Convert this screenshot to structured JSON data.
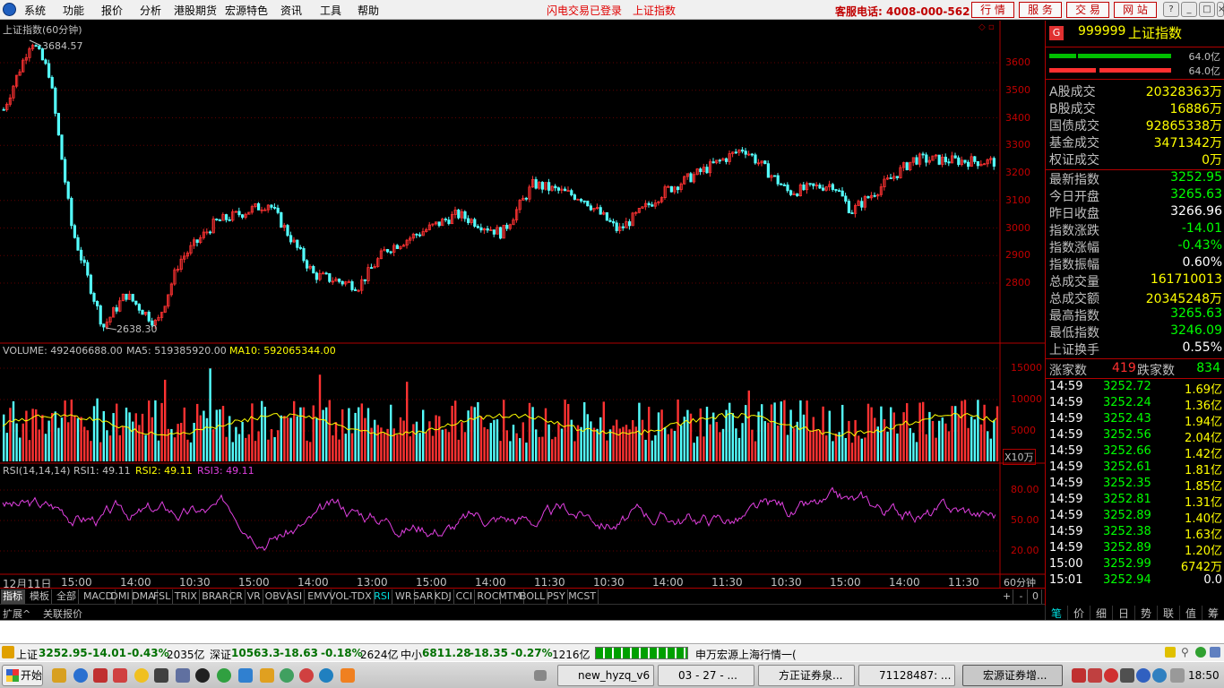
{
  "menu": {
    "items": [
      "系统",
      "功能",
      "报价",
      "分析",
      "港股期货",
      "宏源特色",
      "资讯",
      "工具",
      "帮助"
    ],
    "notice_login": "闪电交易已登录",
    "notice_index": "上证指数",
    "hotline": "客服电话: 4008-000-562",
    "buttons": [
      "行 情",
      "服 务",
      "交 易",
      "网 站"
    ],
    "window_controls": [
      "?",
      "_",
      "□",
      "×"
    ]
  },
  "price_chart": {
    "title": "上证指数(60分钟)",
    "high_label": "3684.57",
    "low_label": "2638.30",
    "y_ticks": [
      "3600",
      "3500",
      "3400",
      "3300",
      "3200",
      "3100",
      "3000",
      "2900",
      "2800"
    ]
  },
  "volume_chart": {
    "label_volume": "VOLUME: 492406688.00",
    "label_ma5": "MA5: 519385920.00",
    "label_ma10": "MA10: 592065344.00",
    "y_ticks": [
      "15000",
      "10000",
      "5000"
    ],
    "unit": "X10万"
  },
  "rsi_chart": {
    "label_params": "RSI(14,14,14)",
    "label_rsi1": "RSI1: 49.11",
    "label_rsi2": "RSI2: 49.11",
    "label_rsi3": "RSI3: 49.11",
    "y_ticks": [
      "80.00",
      "50.00",
      "20.00"
    ]
  },
  "time_axis": {
    "labels": [
      "12月11日",
      "15:00",
      "14:00",
      "10:30",
      "15:00",
      "14:00",
      "13:00",
      "15:00",
      "14:00",
      "11:30",
      "10:30",
      "14:00",
      "11:30",
      "10:30",
      "15:00",
      "14:00",
      "11:30",
      "10:30"
    ],
    "period": "60分钟"
  },
  "indicator_tabs": [
    "指标",
    "模板",
    "全部",
    "MACD",
    "DMI",
    "DMA",
    "FSL",
    "TRIX",
    "BRAR",
    "CR",
    "VR",
    "OBV",
    "ASI",
    "EMV",
    "VOL-TDX",
    "RSI",
    "WR",
    "SAR",
    "KDJ",
    "CCI",
    "ROC",
    "MTM",
    "BOLL",
    "PSY",
    "MCST"
  ],
  "indicator_controls": [
    "+",
    "-",
    "0"
  ],
  "sub_tabs": [
    "扩展^",
    "关联报价"
  ],
  "quote": {
    "badge": "G",
    "code": "999999",
    "name": "上证指数",
    "bar_top_label": "64.0亿",
    "bar_bottom_label": "64.0亿",
    "section1": [
      {
        "k": "A股成交",
        "v": "20328363万"
      },
      {
        "k": "B股成交",
        "v": "16886万"
      },
      {
        "k": "国债成交",
        "v": "92865338万"
      },
      {
        "k": "基金成交",
        "v": "3471342万"
      },
      {
        "k": "权证成交",
        "v": "0万"
      }
    ],
    "section2": [
      {
        "k": "最新指数",
        "v": "3252.95",
        "c": "#00ff00"
      },
      {
        "k": "今日开盘",
        "v": "3265.63",
        "c": "#00ff00"
      },
      {
        "k": "昨日收盘",
        "v": "3266.96",
        "c": "#ffffff"
      },
      {
        "k": "指数涨跌",
        "v": "-14.01",
        "c": "#00ff00"
      },
      {
        "k": "指数涨幅",
        "v": "-0.43%",
        "c": "#00ff00"
      },
      {
        "k": "指数振幅",
        "v": "0.60%",
        "c": "#ffffff"
      },
      {
        "k": "总成交量",
        "v": "161710013",
        "c": "#ffff00"
      },
      {
        "k": "总成交额",
        "v": "20345248万",
        "c": "#ffff00"
      },
      {
        "k": "最高指数",
        "v": "3265.63",
        "c": "#00ff00"
      },
      {
        "k": "最低指数",
        "v": "3246.09",
        "c": "#00ff00"
      },
      {
        "k": "上证换手",
        "v": "0.55%",
        "c": "#ffffff"
      }
    ],
    "up_label": "涨家数",
    "up_value": "419",
    "down_label": "跌家数",
    "down_value": "834"
  },
  "ticks": [
    {
      "t": "14:59",
      "p": "3252.72",
      "a": "1.69亿"
    },
    {
      "t": "14:59",
      "p": "3252.24",
      "a": "1.36亿"
    },
    {
      "t": "14:59",
      "p": "3252.43",
      "a": "1.94亿"
    },
    {
      "t": "14:59",
      "p": "3252.56",
      "a": "2.04亿"
    },
    {
      "t": "14:59",
      "p": "3252.66",
      "a": "1.42亿"
    },
    {
      "t": "14:59",
      "p": "3252.61",
      "a": "1.81亿"
    },
    {
      "t": "14:59",
      "p": "3252.35",
      "a": "1.85亿"
    },
    {
      "t": "14:59",
      "p": "3252.81",
      "a": "1.31亿"
    },
    {
      "t": "14:59",
      "p": "3252.89",
      "a": "1.40亿"
    },
    {
      "t": "14:59",
      "p": "3252.38",
      "a": "1.63亿"
    },
    {
      "t": "14:59",
      "p": "3252.89",
      "a": "1.20亿"
    },
    {
      "t": "15:00",
      "p": "3252.99",
      "a": "6742万"
    },
    {
      "t": "15:01",
      "p": "3252.94",
      "a": "0.0"
    }
  ],
  "rp_tabs": [
    "笔",
    "价",
    "细",
    "日",
    "势",
    "联",
    "值",
    "筹"
  ],
  "status": {
    "sh_name": "上证",
    "sh_value": "3252.95",
    "sh_change": "-14.01",
    "sh_pct": "-0.43%",
    "sh_amount": "2035亿",
    "sz_name": "深证",
    "sz_value": "10563.3",
    "sz_change": "-18.63",
    "sz_pct": "-0.18%",
    "sz_amount": "2624亿",
    "zx_name": "中小",
    "zx_value": "6811.28",
    "zx_change": "-18.35",
    "zx_pct": "-0.27%",
    "zx_amount": "1216亿",
    "ticker": "申万宏源上海行情一("
  },
  "taskbar": {
    "start": "开始",
    "tasks": [
      "new_hyzq_v6",
      "03 - 27 - ...",
      "方正证券泉...",
      "71128487: ...",
      "宏源证券增..."
    ],
    "clock": "18:50"
  },
  "colors": {
    "up": "#ff3232",
    "down": "#54ffff",
    "ma": "#ffff00",
    "rsi": "#e040e0",
    "grid": "#b00000"
  }
}
